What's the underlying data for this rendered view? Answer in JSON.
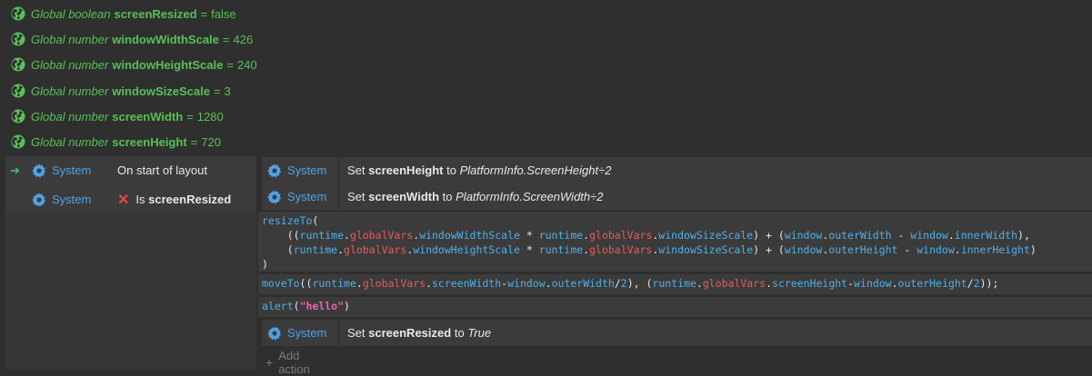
{
  "globals": [
    {
      "kw": "Global boolean",
      "name": "screenResized",
      "eq": "=",
      "value": "false"
    },
    {
      "kw": "Global number",
      "name": "windowWidthScale",
      "eq": "=",
      "value": "426"
    },
    {
      "kw": "Global number",
      "name": "windowHeightScale",
      "eq": "=",
      "value": "240"
    },
    {
      "kw": "Global number",
      "name": "windowSizeScale",
      "eq": "=",
      "value": "3"
    },
    {
      "kw": "Global number",
      "name": "screenWidth",
      "eq": "=",
      "value": "1280"
    },
    {
      "kw": "Global number",
      "name": "screenHeight",
      "eq": "=",
      "value": "720"
    }
  ],
  "event": {
    "arrow": "➔",
    "conditions": [
      {
        "object": "System",
        "text": "On start of layout"
      },
      {
        "object": "System",
        "prefix": "Is",
        "name": "screenResized"
      }
    ],
    "actions": [
      {
        "object": "System",
        "verb": "Set",
        "name": "screenHeight",
        "to": "to",
        "expr": "PlatformInfo.ScreenHeight÷2"
      },
      {
        "object": "System",
        "verb": "Set",
        "name": "screenWidth",
        "to": "to",
        "expr": "PlatformInfo.ScreenWidth÷2"
      }
    ],
    "last_action": {
      "object": "System",
      "verb": "Set",
      "name": "screenResized",
      "to": "to",
      "expr": "True"
    },
    "add_action": "Add action"
  },
  "js": {
    "resize_open": "resizeTo",
    "runtime": "runtime",
    "globalVars": "globalVars",
    "windowWidthScale": "windowWidthScale",
    "windowHeightScale": "windowHeightScale",
    "windowSizeScale": "windowSizeScale",
    "screenWidth": "screenWidth",
    "screenHeight": "screenHeight",
    "window": "window",
    "outerWidth": "outerWidth",
    "innerWidth": "innerWidth",
    "outerHeight": "outerHeight",
    "innerHeight": "innerHeight",
    "moveTo": "moveTo",
    "alert": "alert",
    "hello": "\"hello\"",
    "two": "2"
  },
  "colors": {
    "background": "#2f2f2f",
    "global_green": "#57c057",
    "object_blue": "#4fa3e6",
    "invert_red": "#e04848",
    "string_pink": "#f062a8"
  }
}
